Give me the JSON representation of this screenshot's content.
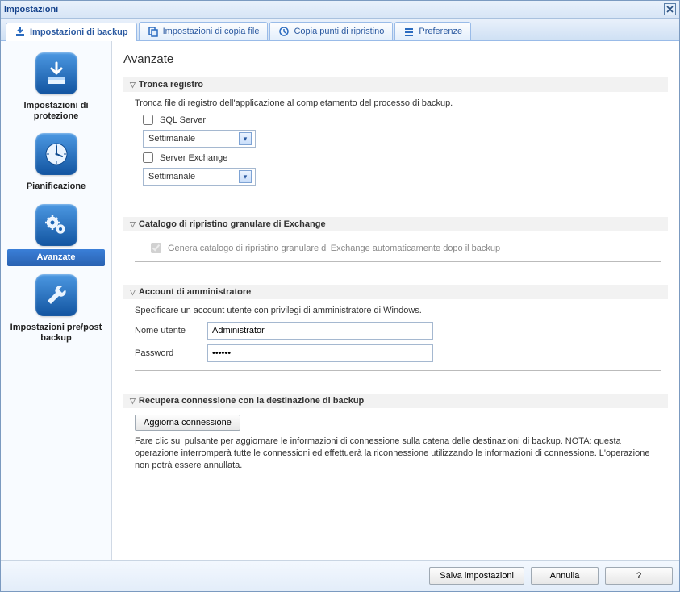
{
  "window": {
    "title": "Impostazioni"
  },
  "tabs": [
    {
      "label": "Impostazioni di backup",
      "icon": "download-disk-icon",
      "active": true
    },
    {
      "label": "Impostazioni di copia file",
      "icon": "copy-icon",
      "active": false
    },
    {
      "label": "Copia punti di ripristino",
      "icon": "restore-point-icon",
      "active": false
    },
    {
      "label": "Preferenze",
      "icon": "prefs-icon",
      "active": false
    }
  ],
  "sidebar": {
    "items": [
      {
        "label": "Impostazioni di protezione",
        "icon": "disk"
      },
      {
        "label": "Pianificazione",
        "icon": "clock"
      },
      {
        "label": "Avanzate",
        "icon": "gear",
        "selected": true
      },
      {
        "label": "Impostazioni pre/post backup",
        "icon": "wrench"
      }
    ]
  },
  "page": {
    "title": "Avanzate"
  },
  "truncate": {
    "header": "Tronca registro",
    "desc": "Tronca file di registro dell'applicazione al completamento del processo di backup.",
    "sql_label": "SQL Server",
    "sql_checked": false,
    "sql_select": "Settimanale",
    "exch_label": "Server Exchange",
    "exch_checked": false,
    "exch_select": "Settimanale"
  },
  "granular": {
    "header": "Catalogo di ripristino granulare di Exchange",
    "gen_label": "Genera catalogo di ripristino granulare di Exchange automaticamente dopo il backup",
    "gen_checked": true,
    "gen_disabled": true
  },
  "admin": {
    "header": "Account di amministratore",
    "desc": "Specificare un account utente con privilegi di amministratore di Windows.",
    "user_label": "Nome utente",
    "user_value": "Administrator",
    "pass_label": "Password",
    "pass_value": "••••••"
  },
  "recover": {
    "header": "Recupera connessione con la destinazione di backup",
    "button": "Aggiorna connessione",
    "note": "Fare clic sul pulsante per aggiornare le informazioni di connessione sulla catena delle destinazioni di backup. NOTA: questa operazione interromperà tutte le connessioni ed effettuerà la riconnessione utilizzando le informazioni di connessione. L'operazione non potrà essere annullata."
  },
  "footer": {
    "save": "Salva impostazioni",
    "cancel": "Annulla",
    "help": "?"
  }
}
